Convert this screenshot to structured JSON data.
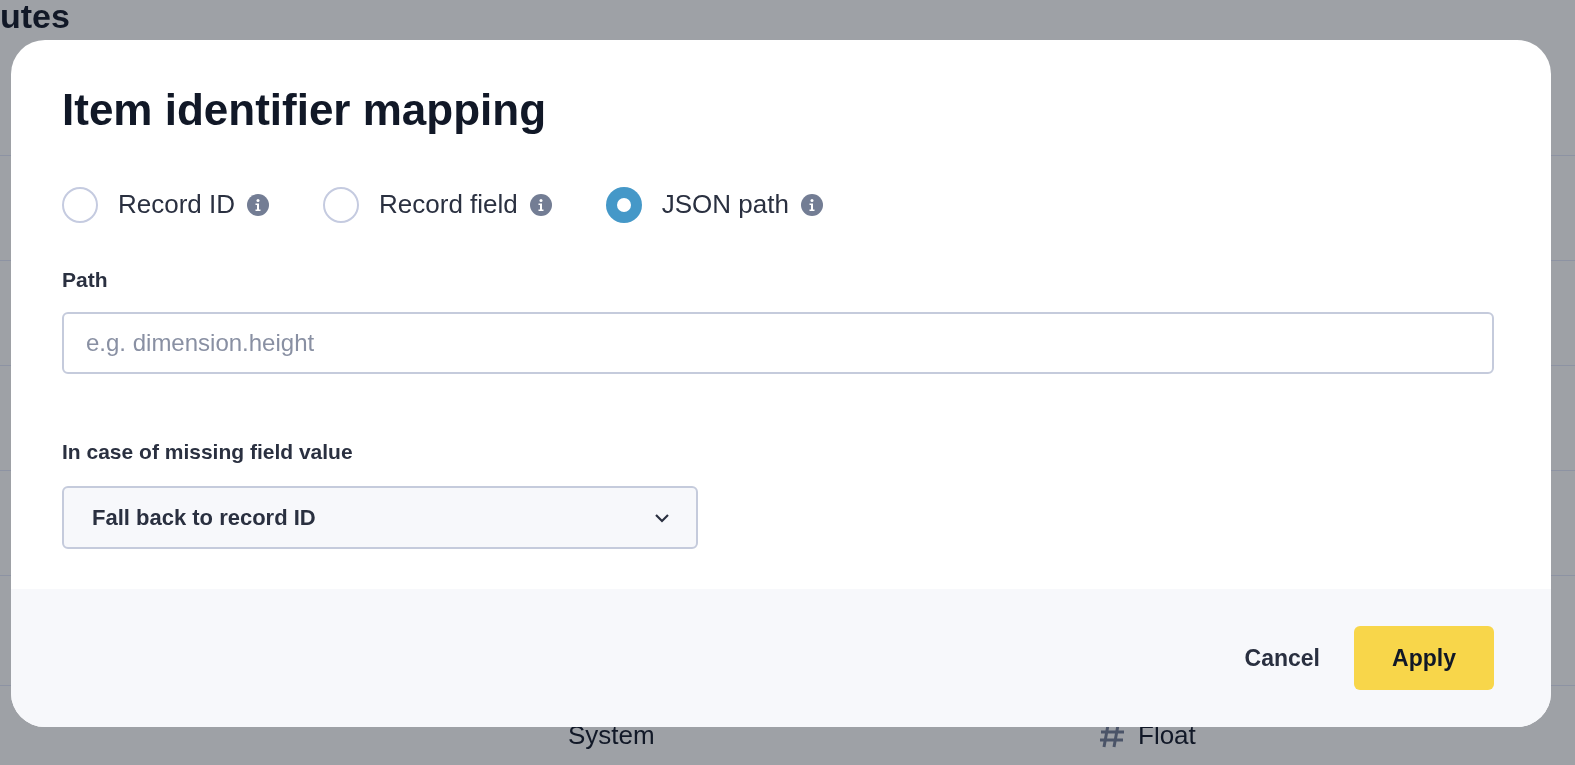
{
  "background": {
    "heading": "utes",
    "cells": [
      {
        "text": "System",
        "kind": "text"
      },
      {
        "text": "Float",
        "kind": "number"
      }
    ]
  },
  "modal": {
    "title": "Item identifier mapping",
    "options": [
      {
        "label": "Record ID",
        "selected": false
      },
      {
        "label": "Record field",
        "selected": false
      },
      {
        "label": "JSON path",
        "selected": true
      }
    ],
    "path_field": {
      "label": "Path",
      "placeholder": "e.g. dimension.height"
    },
    "fallback": {
      "label": "In case of missing field value",
      "value": "Fall back to record ID"
    },
    "buttons": [
      {
        "label": "Cancel",
        "kind": "secondary"
      },
      {
        "label": "Apply",
        "kind": "primary"
      }
    ]
  }
}
